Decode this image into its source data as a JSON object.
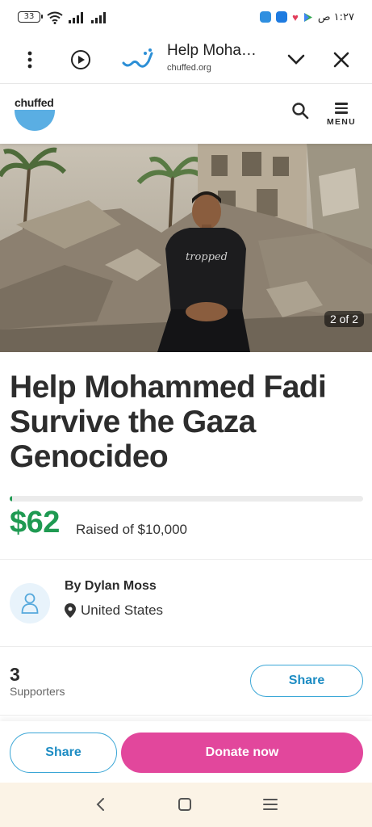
{
  "status_bar": {
    "battery": "33",
    "time": "١:٢٧ ص"
  },
  "browser": {
    "page_title": "Help Moha…",
    "url": "chuffed.org",
    "icons": [
      "more-vert-icon",
      "play-icon",
      "site-logo-icon",
      "chevron-down-icon",
      "close-icon"
    ]
  },
  "site_header": {
    "brand": "chuffed",
    "menu_label": "MENU",
    "brand_color": "#5aaee3"
  },
  "hero": {
    "counter": "2 of 2",
    "shirt_text": "tropped"
  },
  "campaign": {
    "title": "Help Mohammed Fadi Survive the Gaza Genocideo",
    "raised": "$62",
    "raised_of": "Raised of $10,000",
    "progress_fraction": 0.0062,
    "organizer": "By Dylan Moss",
    "location": "United States",
    "supporters_count": "3",
    "supporters_label": "Supporters",
    "share_label": "Share"
  },
  "bottom_bar": {
    "share_label": "Share",
    "donate_label": "Donate now",
    "donate_color": "#e2479c",
    "accent_green": "#1f9a52"
  },
  "nav": {
    "icons": [
      "back-icon",
      "home-icon",
      "recents-icon"
    ]
  }
}
